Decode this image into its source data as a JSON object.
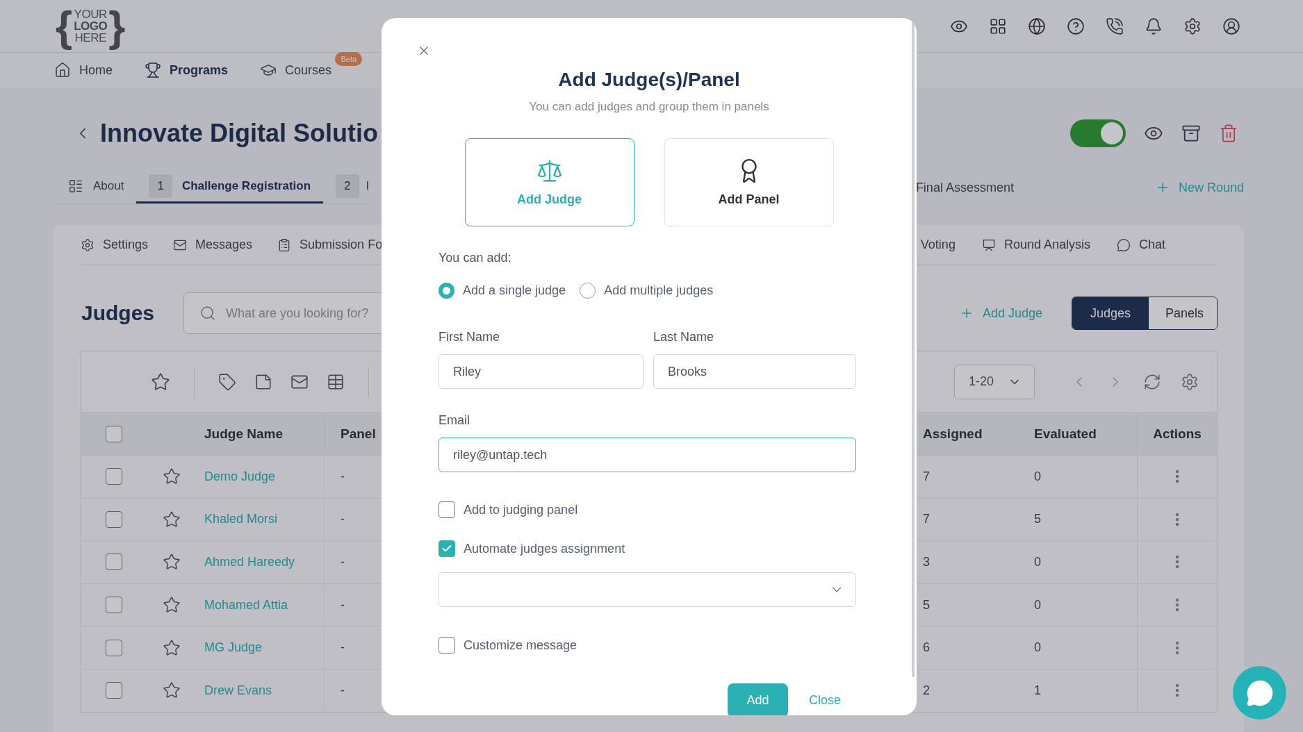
{
  "logo": {
    "open": "{",
    "lines": [
      "YOUR",
      "LOGO",
      "HERE"
    ],
    "close": "}"
  },
  "nav": [
    {
      "label": "Home",
      "kind": "home",
      "selected": false
    },
    {
      "label": "Programs",
      "kind": "programs",
      "selected": true
    },
    {
      "label": "Courses",
      "kind": "courses",
      "selected": false,
      "badge": "Beta"
    }
  ],
  "page": {
    "title": "Innovate Digital Solutio",
    "published": true
  },
  "rounds": [
    {
      "label": "About",
      "kind": "about",
      "selected": false
    },
    {
      "number": "1",
      "label": "Challenge Registration",
      "kind": "round",
      "selected": true
    },
    {
      "number": "2",
      "label": "I",
      "kind": "round",
      "selected": false
    }
  ],
  "rounds_right": {
    "label": "Final Assessment",
    "new_round": "New Round"
  },
  "subtabs_left": [
    {
      "label": "Settings",
      "kind": "settings"
    },
    {
      "label": "Messages",
      "kind": "messages"
    },
    {
      "label": "Submission Fo",
      "kind": "form"
    }
  ],
  "subtabs_right": [
    {
      "label": "Voting",
      "kind": "voting"
    },
    {
      "label": "Round Analysis",
      "kind": "analysis"
    },
    {
      "label": "Chat",
      "kind": "chat"
    }
  ],
  "judges": {
    "heading": "Judges",
    "search_placeholder": "What are you looking for?",
    "add_link": "Add Judge",
    "views": [
      {
        "label": "Judges",
        "selected": true
      },
      {
        "label": "Panels",
        "selected": false
      }
    ],
    "page_size": "1-20"
  },
  "table": {
    "header_checked": false,
    "columns_left": [
      "Judge Name",
      "Panel"
    ],
    "columns_right": [
      "Assigned",
      "Evaluated",
      "Actions"
    ],
    "rows": [
      {
        "name": "Demo Judge",
        "panel": "-",
        "assigned": "7",
        "evaluated": "0",
        "checked": false,
        "starred": false
      },
      {
        "name": "Khaled Morsi",
        "panel": "-",
        "assigned": "7",
        "evaluated": "5",
        "checked": false,
        "starred": false
      },
      {
        "name": "Ahmed Hareedy",
        "panel": "-",
        "assigned": "3",
        "evaluated": "0",
        "checked": false,
        "starred": false
      },
      {
        "name": "Mohamed Attia",
        "panel": "-",
        "assigned": "5",
        "evaluated": "0",
        "checked": false,
        "starred": false
      },
      {
        "name": "MG Judge",
        "panel": "-",
        "assigned": "6",
        "evaluated": "0",
        "checked": false,
        "starred": false
      },
      {
        "name": "Drew Evans",
        "panel": "-",
        "assigned": "2",
        "evaluated": "1",
        "checked": false,
        "starred": false
      }
    ]
  },
  "modal": {
    "title": "Add Judge(s)/Panel",
    "subtitle": "You can add judges and group them in panels",
    "options": [
      {
        "label": "Add Judge",
        "kind": "judge",
        "selected": true
      },
      {
        "label": "Add Panel",
        "kind": "panel",
        "selected": false
      }
    ],
    "you_can_add": "You can add:",
    "modes": [
      {
        "label": "Add a single judge",
        "selected": true
      },
      {
        "label": "Add multiple judges",
        "selected": false
      }
    ],
    "first_name": {
      "label": "First Name",
      "value": "Riley"
    },
    "last_name": {
      "label": "Last Name",
      "value": "Brooks"
    },
    "email": {
      "label": "Email",
      "value": "riley@untap.tech"
    },
    "checks": [
      {
        "label": "Add to judging panel",
        "checked": false
      },
      {
        "label": "Automate judges assignment",
        "checked": true
      }
    ],
    "customize": {
      "label": "Customize message",
      "checked": false
    },
    "add_button": "Add",
    "close_button": "Close"
  }
}
